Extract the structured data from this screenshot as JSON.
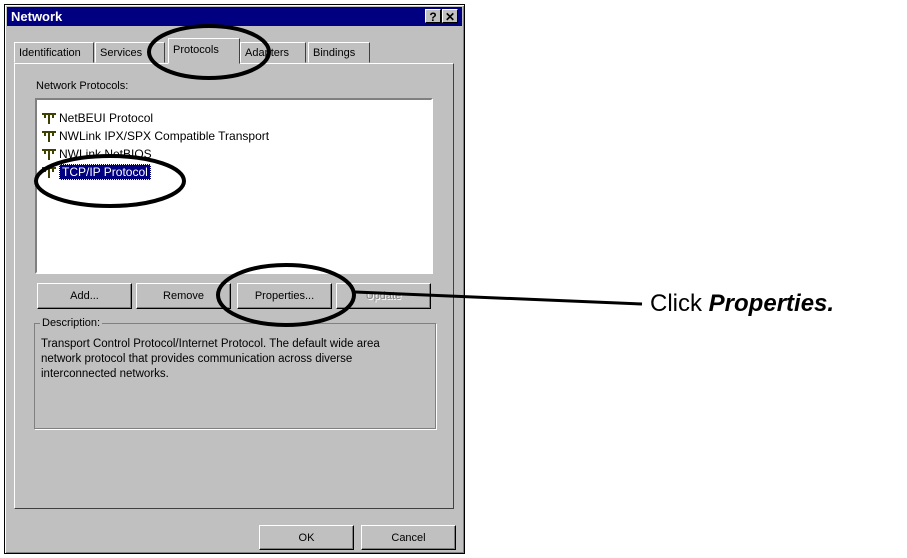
{
  "window": {
    "title": "Network",
    "help_button": "?",
    "close_button": "✕"
  },
  "tabs": [
    {
      "label": "Identification"
    },
    {
      "label": "Services"
    },
    {
      "label": "Protocols"
    },
    {
      "label": "Adapters"
    },
    {
      "label": "Bindings"
    }
  ],
  "active_tab": "Protocols",
  "protocols_panel": {
    "list_label": "Network Protocols:",
    "items": [
      {
        "label": "NetBEUI Protocol"
      },
      {
        "label": "NWLink IPX/SPX Compatible Transport"
      },
      {
        "label": "NWLink NetBIOS"
      },
      {
        "label": "TCP/IP Protocol",
        "selected": true
      }
    ],
    "buttons": {
      "add": "Add...",
      "remove": "Remove",
      "properties": "Properties...",
      "update": "Update"
    },
    "description_label": "Description:",
    "description": "Transport Control Protocol/Internet Protocol. The default wide area network protocol that provides communication across diverse interconnected networks."
  },
  "footer": {
    "ok": "OK",
    "cancel": "Cancel"
  },
  "annotation": {
    "prefix": "Click ",
    "emphasis": "Properties."
  },
  "colors": {
    "titlebar": "#000080",
    "face": "#c0c0c0",
    "selection": "#000080"
  }
}
